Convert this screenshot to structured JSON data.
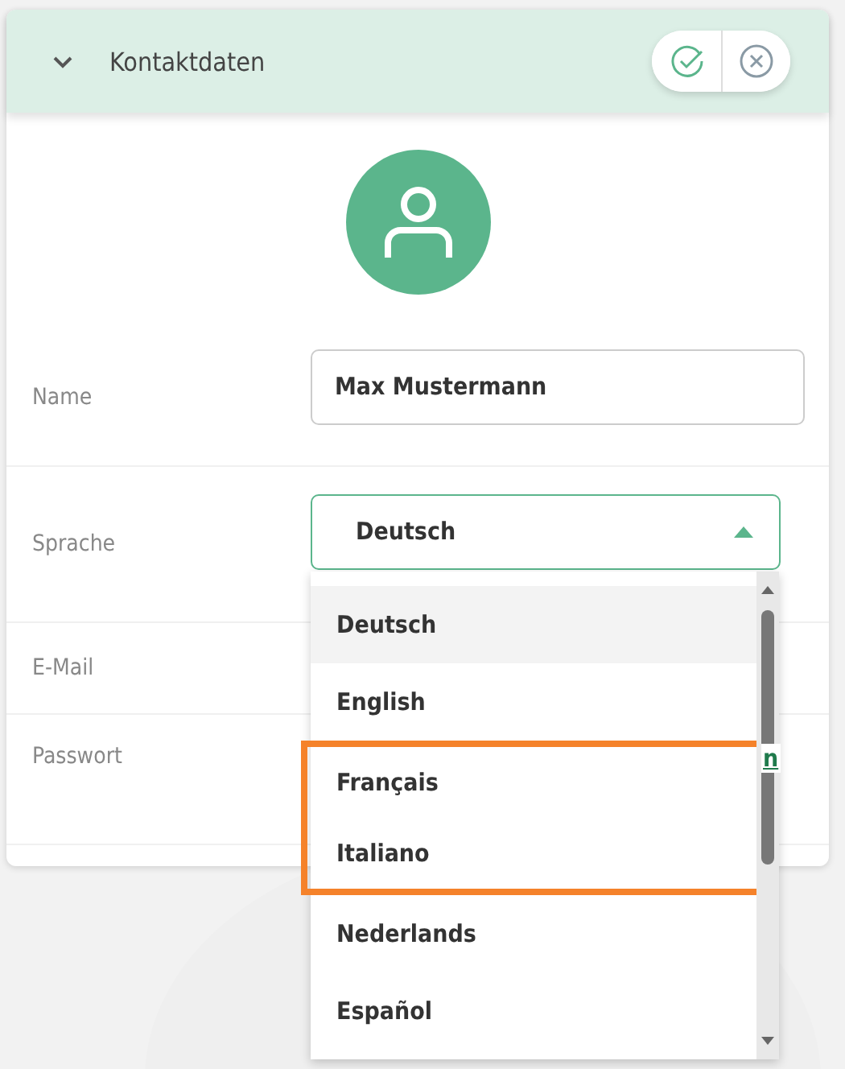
{
  "header": {
    "title": "Kontaktdaten",
    "expanded": true
  },
  "fields": [
    {
      "kind": "input",
      "label": "Name",
      "value": "Max Mustermann"
    },
    {
      "kind": "select",
      "label": "Sprache",
      "value": "Deutsch",
      "open": true
    },
    {
      "kind": "text",
      "label": "E-Mail"
    },
    {
      "kind": "link",
      "label": "Passwort",
      "link": "n"
    }
  ],
  "dropdown": {
    "options": [
      {
        "label": "Deutsch",
        "selected": true,
        "highlighted": false
      },
      {
        "label": "English",
        "selected": false,
        "highlighted": false
      },
      {
        "label": "Français",
        "selected": false,
        "highlighted": true
      },
      {
        "label": "Italiano",
        "selected": false,
        "highlighted": true
      },
      {
        "label": "Nederlands",
        "selected": false,
        "highlighted": false
      },
      {
        "label": "Español",
        "selected": false,
        "highlighted": false
      }
    ]
  }
}
